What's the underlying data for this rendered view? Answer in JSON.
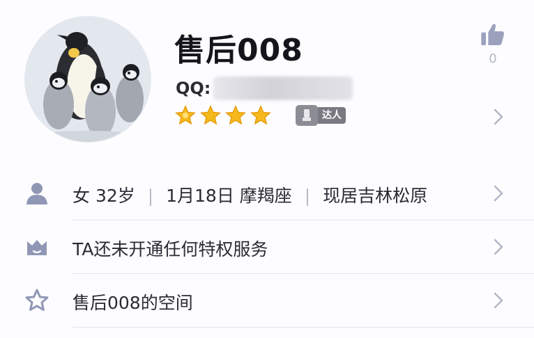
{
  "profile": {
    "name": "售后008",
    "qq_label": "QQ:",
    "star_count": 4,
    "badge_label": "达人",
    "like_count": "0"
  },
  "info": {
    "gender": "女",
    "age": "32岁",
    "birthday": "1月18日",
    "zodiac": "摩羯座",
    "location": "现居吉林松原",
    "separator": "|"
  },
  "privilege": {
    "text": "TA还未开通任何特权服务"
  },
  "space": {
    "text": "售后008的空间"
  },
  "colors": {
    "star": "#f5b91c",
    "icon": "#9097b5",
    "chevron": "#b4b8c6",
    "like_icon": "#9ba1bd"
  },
  "icons": {
    "avatar": "penguin-avatar",
    "stars": "star-icon",
    "badge": "expert-badge-icon",
    "like": "thumbs-up-icon",
    "info": "person-icon",
    "privilege": "crown-icon",
    "space": "star-outline-icon",
    "chevron": "chevron-right-icon"
  }
}
